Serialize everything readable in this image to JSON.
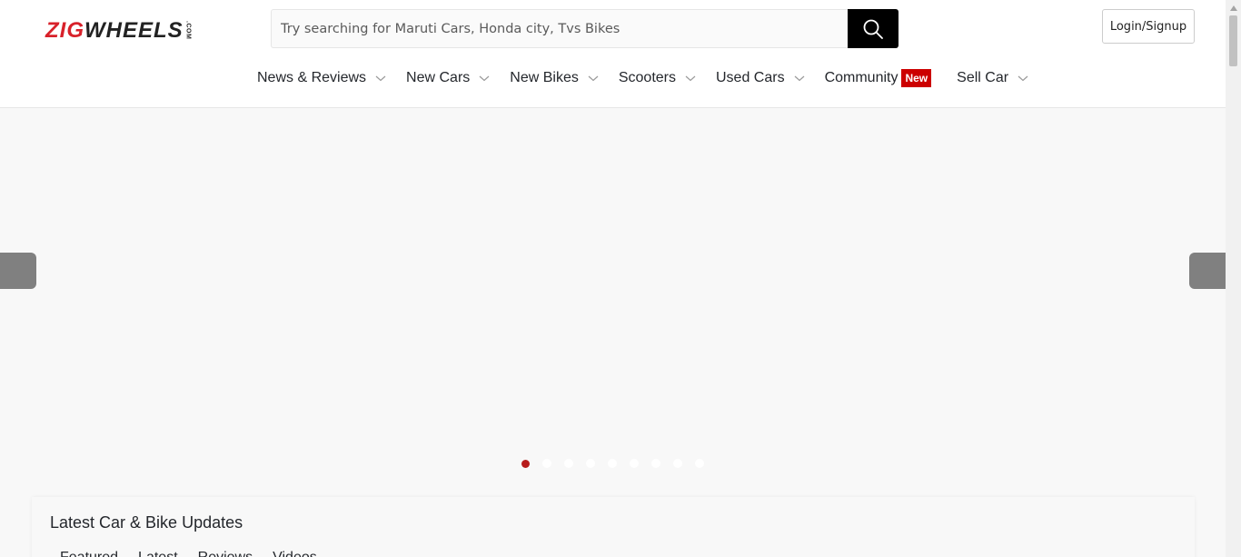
{
  "header": {
    "logo": {
      "part1": "ZIG",
      "part2": "WHEELS",
      "suffix": ".COM"
    },
    "search": {
      "placeholder": "Try searching for Maruti Cars, Honda city, Tvs Bikes"
    },
    "search_icon": "search-icon",
    "login_label": "Login/Signup"
  },
  "nav": {
    "items": [
      {
        "label": "News & Reviews"
      },
      {
        "label": "New Cars"
      },
      {
        "label": "New Bikes"
      },
      {
        "label": "Scooters"
      },
      {
        "label": "Used Cars"
      },
      {
        "label": "Community",
        "badge": "New"
      },
      {
        "label": "Sell Car"
      }
    ]
  },
  "banner": {
    "dot_count": 9,
    "active_dot": 0
  },
  "updates": {
    "title": "Latest Car & Bike Updates",
    "tabs": [
      {
        "label": "Featured"
      },
      {
        "label": "Latest"
      },
      {
        "label": "Reviews"
      },
      {
        "label": "Videos"
      }
    ]
  },
  "colors": {
    "brand_red": "#d8212a",
    "badge_red": "#cc0000",
    "active_dot": "#b71c1c"
  }
}
